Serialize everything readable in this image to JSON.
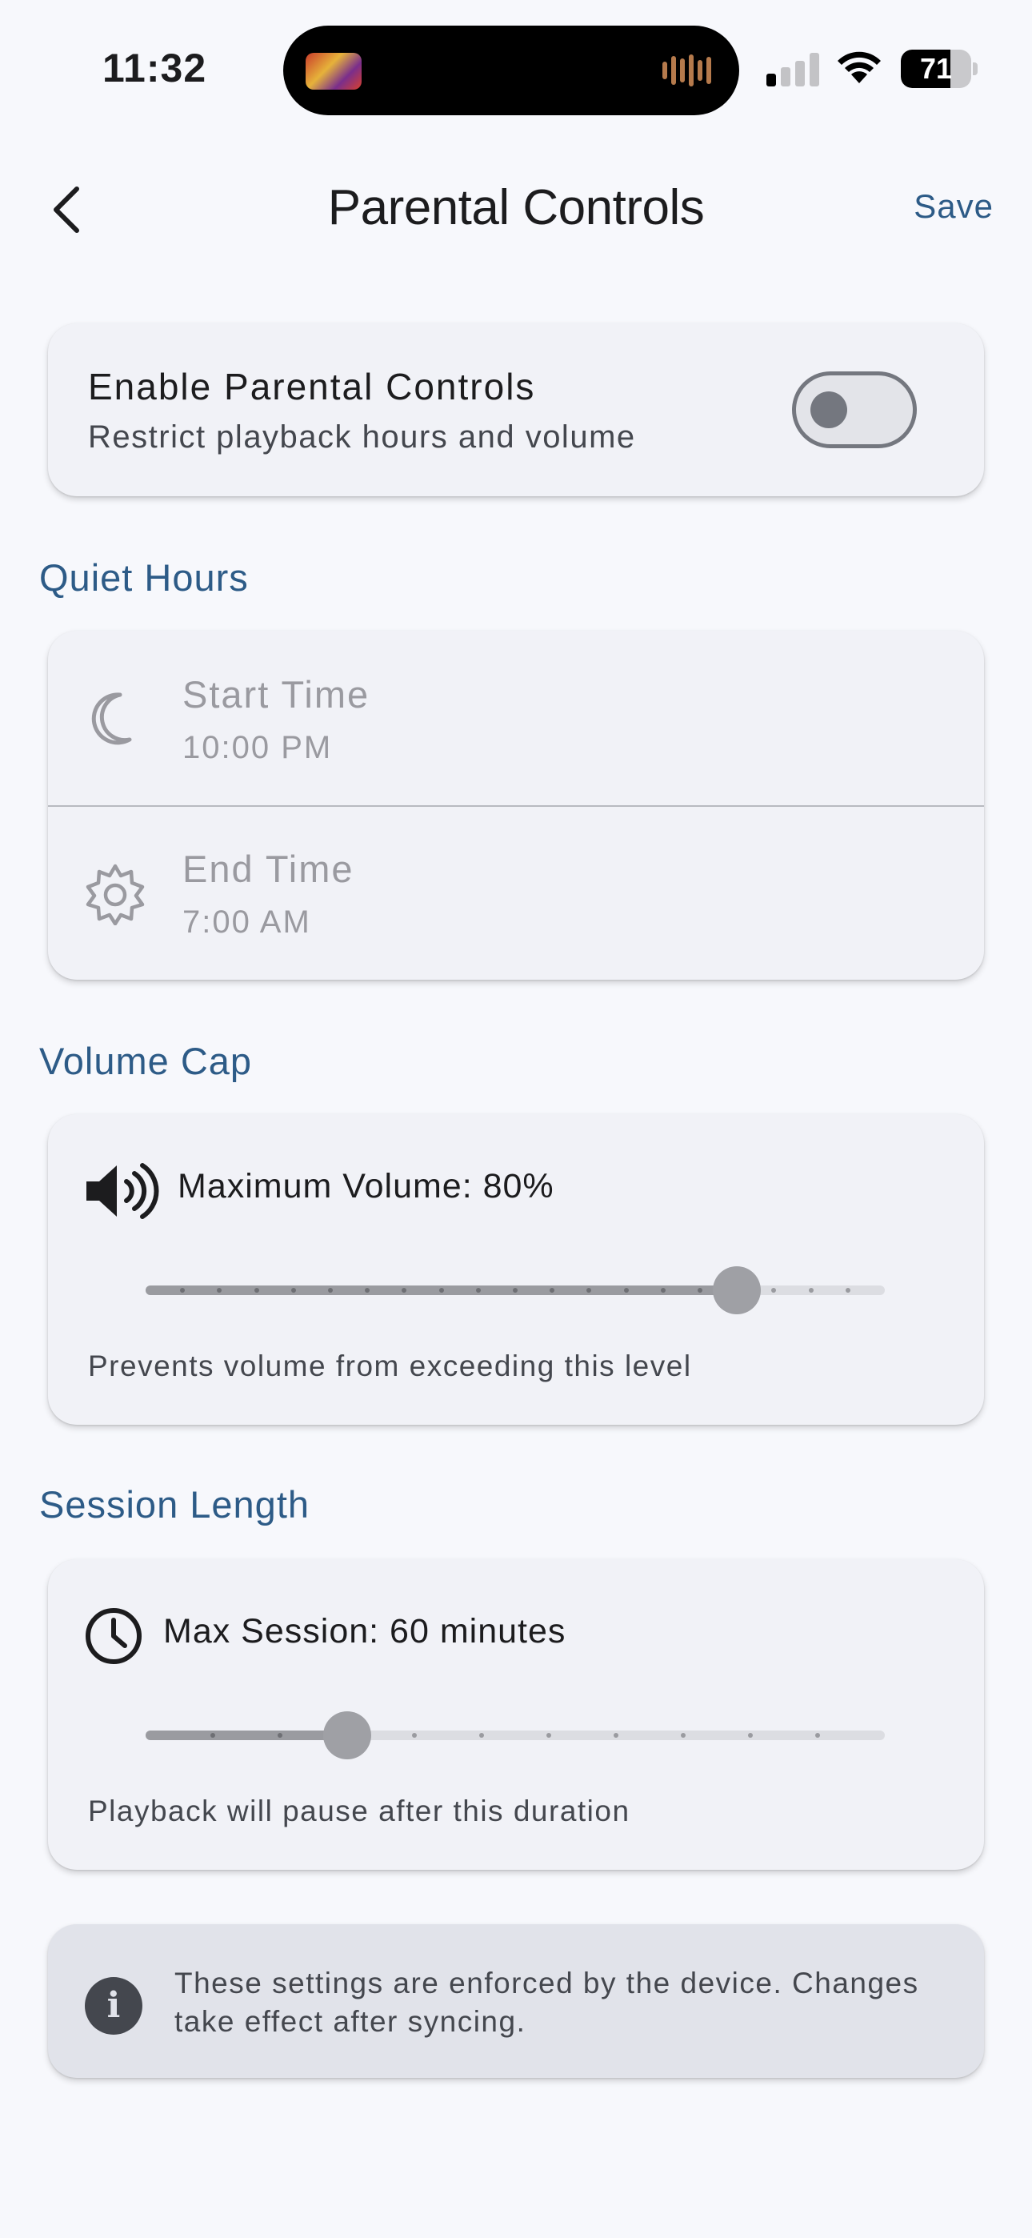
{
  "status_bar": {
    "time": "11:32",
    "battery_level": 71,
    "battery_text": "71",
    "signal_bars_active": 1,
    "icons": [
      "signal-icon",
      "wifi-icon",
      "battery-icon"
    ]
  },
  "header": {
    "back_icon": "chevron-left-icon",
    "title": "Parental Controls",
    "save_label": "Save"
  },
  "enable": {
    "title": "Enable Parental Controls",
    "subtitle": "Restrict playback hours and volume",
    "enabled": false
  },
  "quiet_hours": {
    "section_title": "Quiet Hours",
    "start": {
      "icon": "moon-icon",
      "label": "Start Time",
      "value": "10:00 PM"
    },
    "end": {
      "icon": "sun-icon",
      "label": "End Time",
      "value": "7:00 AM"
    }
  },
  "volume_cap": {
    "section_title": "Volume Cap",
    "icon": "speaker-icon",
    "label": "Maximum Volume: 80%",
    "value_percent": 80,
    "steps": 20,
    "help": "Prevents volume from exceeding this level"
  },
  "session_length": {
    "section_title": "Session Length",
    "icon": "clock-icon",
    "label": "Max Session: 60 minutes",
    "value_fraction": 0.2727,
    "steps": 11,
    "help": "Playback will pause after this duration"
  },
  "info": {
    "icon": "info-icon",
    "text": "These settings are enforced by the device. Changes take effect after syncing."
  },
  "colors": {
    "accent": "#2d5b87",
    "background": "#f7f8fc",
    "card": "#f1f2f7",
    "info_card": "#e1e3ea",
    "disabled_text": "#9a9aa0"
  }
}
